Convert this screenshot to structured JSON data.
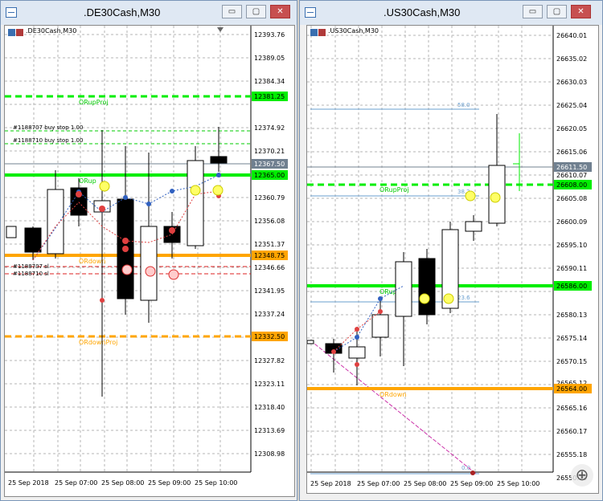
{
  "left": {
    "title": ".DE30Cash,M30",
    "symbol": ".DE30Cash,M30",
    "prices": [
      "12393.76",
      "12389.05",
      "12384.34",
      "12374.92",
      "12370.21",
      "12360.79",
      "12356.08",
      "12351.37",
      "12346.66",
      "12341.95",
      "12337.24",
      "12327.82",
      "12323.11",
      "12318.40",
      "12313.69",
      "12308.98"
    ],
    "badges": [
      {
        "text": "12381.25",
        "color": "#00ee00"
      },
      {
        "text": "12367.50",
        "color": "#708090"
      },
      {
        "text": "12365.00",
        "color": "#00ee00"
      },
      {
        "text": "12348.75",
        "color": "#ffa500"
      },
      {
        "text": "12332.50",
        "color": "#ffa500"
      }
    ],
    "times": [
      "25 Sep 2018",
      "25 Sep 07:00",
      "25 Sep 08:00",
      "25 Sep 09:00",
      "25 Sep 10:00"
    ],
    "labels": {
      "orup_proj": "ORupProj",
      "orup": "ORup",
      "ordown": "ORdown",
      "ordown_proj": "ORdownProj",
      "buy1": "#1188707 buy stop 1.00",
      "buy2": "#1188710 buy stop 1.00",
      "sl1": "#1188707 sl",
      "sl2": "#1188710 sl"
    }
  },
  "right": {
    "title": ".US30Cash,M30",
    "symbol": ".US30Cash,M30",
    "prices": [
      "26640.01",
      "26635.02",
      "26630.03",
      "26625.04",
      "26620.05",
      "26615.06",
      "26610.07",
      "26605.08",
      "26600.09",
      "26595.10",
      "26590.11",
      "26580.13",
      "26575.14",
      "26570.15",
      "26565.16",
      "26560.17",
      "26555.18",
      "26550.19"
    ],
    "badges": [
      {
        "text": "26611.50",
        "color": "#708090"
      },
      {
        "text": "26608.00",
        "color": "#00ee00"
      },
      {
        "text": "26586.00",
        "color": "#00ee00"
      },
      {
        "text": "26564.00",
        "color": "#ffa500"
      }
    ],
    "cut_label": "26565.12",
    "times": [
      "25 Sep 2018",
      "25 Sep 07:00",
      "25 Sep 08:00",
      "25 Sep 09:00",
      "25 Sep 10:00"
    ],
    "labels": {
      "orup_proj": "ORupProj",
      "orup": "ORup",
      "ordown": "ORdown",
      "fib_58": "58.0",
      "fib_38": "38.2",
      "fib_23": "23.6",
      "fib_0": "0.0"
    }
  },
  "window_buttons": {
    "minimize": "▭",
    "restore": "▢",
    "close": "✕"
  },
  "zoom_glyph": "⊕"
}
